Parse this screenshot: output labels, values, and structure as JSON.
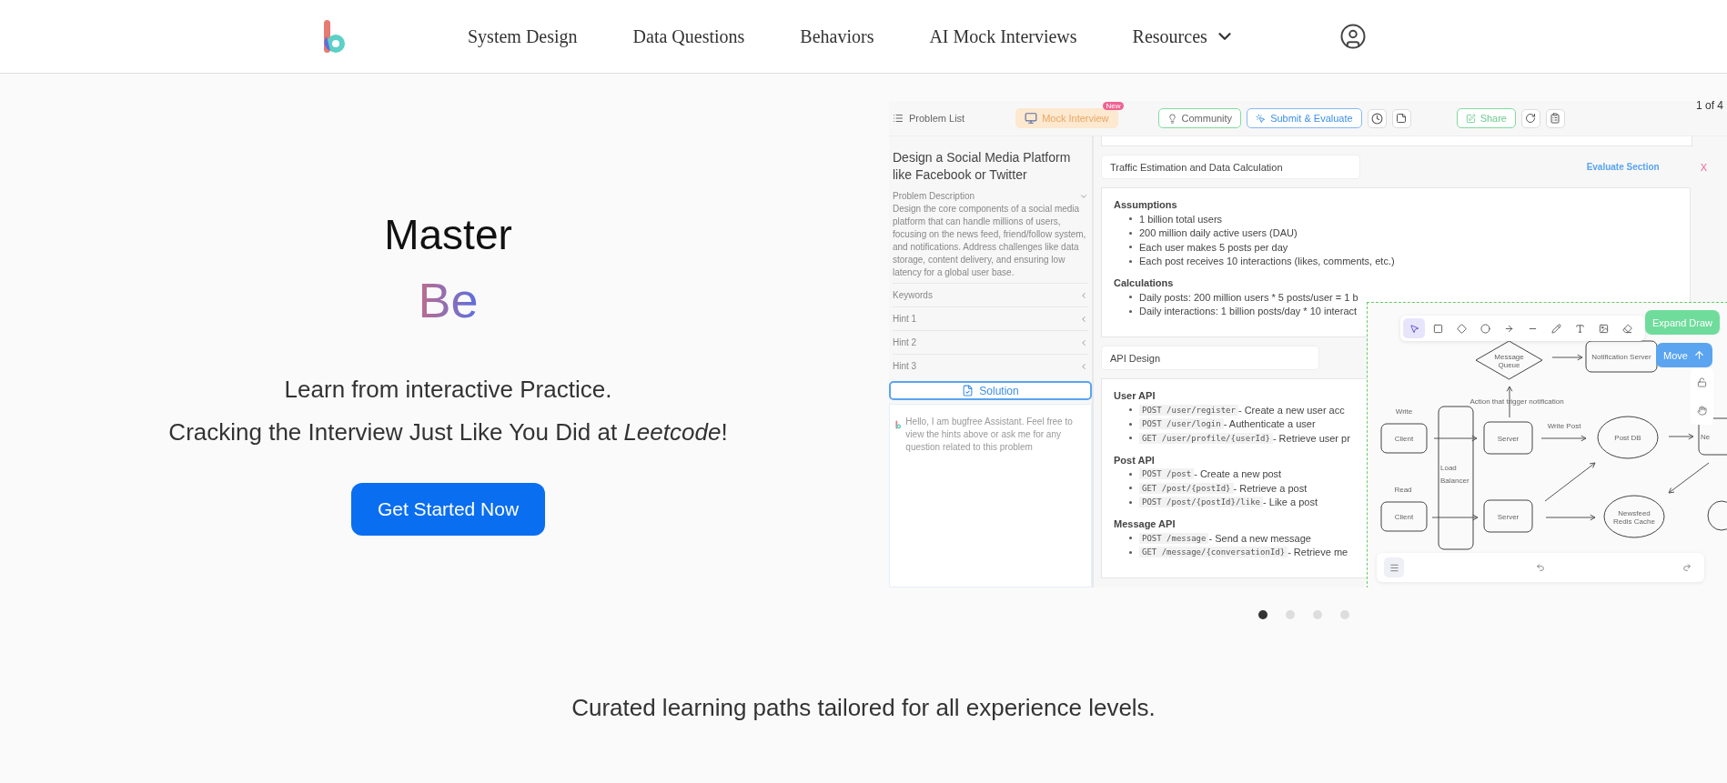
{
  "nav": {
    "items": [
      {
        "label": "System Design",
        "has_menu": false
      },
      {
        "label": "Data Questions",
        "has_menu": false
      },
      {
        "label": "Behaviors",
        "has_menu": false
      },
      {
        "label": "AI Mock Interviews",
        "has_menu": false
      },
      {
        "label": "Resources",
        "has_menu": true
      }
    ]
  },
  "hero": {
    "title": "Master",
    "word": "Be",
    "lines": [
      "Learn from interactive Practice.",
      "Cracking the Interview Just Like You Did at *Leetcode*!"
    ],
    "cta": "Get Started Now"
  },
  "carousel": {
    "counter": "1 of 4",
    "dots": [
      {
        "selected": true
      },
      {
        "selected": false
      },
      {
        "selected": false
      },
      {
        "selected": false
      }
    ],
    "slide": {
      "toolbar": {
        "problem_list": "Problem List",
        "mock_interview": "Mock Interview",
        "badge": "New",
        "community": "Community",
        "submit": "Submit & Evaluate",
        "share": "Share"
      },
      "problem": {
        "title": "Design a Social Media Platform like Facebook or Twitter",
        "description_label": "Problem Description",
        "description": "Design the core components of a social media platform that can handle millions of users, focusing on the news feed, friend/follow system, and notifications. Address challenges like data storage, content delivery, and ensuring low latency for a global user base.",
        "sections": [
          {
            "label": "Keywords"
          },
          {
            "label": "Hint 1"
          },
          {
            "label": "Hint 2"
          },
          {
            "label": "Hint 3"
          }
        ],
        "solution": "Solution",
        "assistant": "Hello, I am bugfree Assistant. Feel free to view the hints above or ask me for any question related to this problem"
      },
      "answer": [
        {
          "title": "Traffic Estimation and Data Calculation",
          "evaluate": "Evaluate Section",
          "close": "X",
          "groups": [
            {
              "heading": "Assumptions",
              "items": [
                {
                  "text": "1 billion total users"
                },
                {
                  "text": "200 million daily active users (DAU)"
                },
                {
                  "text": "Each user makes 5 posts per day"
                },
                {
                  "text": "Each post receives 10 interactions (likes, comments, etc.)"
                }
              ]
            },
            {
              "heading": "Calculations",
              "items": [
                {
                  "text": "Daily posts: 200 million users * 5 posts/user = 1 b"
                },
                {
                  "text": "Daily interactions: 1 billion posts/day * 10 interact"
                }
              ]
            }
          ]
        },
        {
          "title": "API Design",
          "groups": [
            {
              "heading": "User API",
              "items": [
                {
                  "code": "POST /user/register",
                  "text": " - Create a new user acc"
                },
                {
                  "code": "POST /user/login",
                  "text": " - Authenticate a user"
                },
                {
                  "code": "GET /user/profile/{userId}",
                  "text": " - Retrieve user pr"
                }
              ]
            },
            {
              "heading": "Post API",
              "items": [
                {
                  "code": "POST /post",
                  "text": " - Create a new post"
                },
                {
                  "code": "GET /post/{postId}",
                  "text": " - Retrieve a post"
                },
                {
                  "code": "POST /post/{postId}/like",
                  "text": " - Like a post"
                }
              ]
            },
            {
              "heading": "Message API",
              "items": [
                {
                  "code": "POST /message",
                  "text": " - Send a new message"
                },
                {
                  "code": "GET /message/{conversationId}",
                  "text": " - Retrieve me"
                }
              ]
            }
          ]
        }
      ],
      "diagram": {
        "tools": [
          {
            "selected": true
          },
          {
            "selected": false
          },
          {
            "selected": false
          },
          {
            "selected": false
          },
          {
            "selected": false
          },
          {
            "selected": false
          },
          {
            "selected": false
          },
          {
            "selected": false
          },
          {
            "selected": false
          },
          {
            "selected": false
          }
        ],
        "expand": "Expand Draw",
        "move": "Move",
        "nodes": [
          {
            "kind": "diamond",
            "lines": [
              "Message",
              "Queue"
            ]
          },
          {
            "kind": "box",
            "lines": [
              "Notification Server"
            ]
          },
          {
            "kind": "box",
            "lines": [
              "Client"
            ]
          },
          {
            "kind": "box",
            "lines": [
              "Load",
              "Balancer"
            ]
          },
          {
            "kind": "box",
            "lines": [
              "Server"
            ]
          },
          {
            "kind": "ellipse",
            "lines": [
              "Post DB"
            ]
          },
          {
            "kind": "box",
            "lines": [
              "Ne"
            ]
          },
          {
            "kind": "box",
            "lines": [
              "Client"
            ]
          },
          {
            "kind": "box",
            "lines": [
              "Server"
            ]
          },
          {
            "kind": "ellipse",
            "lines": [
              "Newsfeed",
              "Redis Cache"
            ]
          },
          {
            "kind": "ellipse"
          }
        ],
        "labels": [
          "Write",
          "Action that trigger notification",
          "Write Post",
          "Read"
        ]
      }
    }
  },
  "tagline": "Curated learning paths tailored for all experience levels."
}
